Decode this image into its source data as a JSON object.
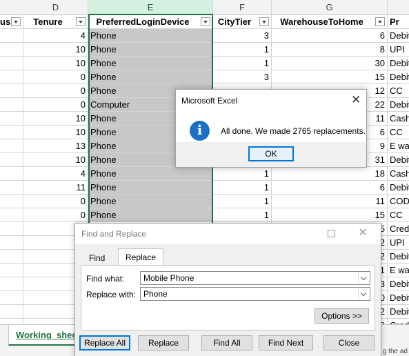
{
  "sheet": {
    "columns": [
      "D",
      "E",
      "F",
      "G"
    ],
    "header_cells": [
      "us",
      "Tenure",
      "PreferredLoginDevice",
      "CityTier",
      "WarehouseToHome",
      "Pr"
    ],
    "rows": [
      {
        "tenure": "4",
        "device": "Phone",
        "tier": "3",
        "wh": "6",
        "pay": "Debit"
      },
      {
        "tenure": "10",
        "device": "Phone",
        "tier": "1",
        "wh": "8",
        "pay": "UPI"
      },
      {
        "tenure": "10",
        "device": "Phone",
        "tier": "1",
        "wh": "30",
        "pay": "Debit"
      },
      {
        "tenure": "0",
        "device": "Phone",
        "tier": "3",
        "wh": "15",
        "pay": "Debit"
      },
      {
        "tenure": "0",
        "device": "Phone",
        "tier": "",
        "wh": "12",
        "pay": "CC"
      },
      {
        "tenure": "0",
        "device": "Computer",
        "tier": "",
        "wh": "22",
        "pay": "Debit"
      },
      {
        "tenure": "10",
        "device": "Phone",
        "tier": "",
        "wh": "11",
        "pay": "Cash"
      },
      {
        "tenure": "10",
        "device": "Phone",
        "tier": "",
        "wh": "6",
        "pay": "CC"
      },
      {
        "tenure": "13",
        "device": "Phone",
        "tier": "",
        "wh": "9",
        "pay": "E wal"
      },
      {
        "tenure": "10",
        "device": "Phone",
        "tier": "",
        "wh": "31",
        "pay": "Debit"
      },
      {
        "tenure": "4",
        "device": " Phone",
        "tier": "1",
        "wh": "18",
        "pay": "Cash"
      },
      {
        "tenure": "11",
        "device": " Phone",
        "tier": "1",
        "wh": "6",
        "pay": "Debit"
      },
      {
        "tenure": "0",
        "device": "Phone",
        "tier": "1",
        "wh": "11",
        "pay": "COD"
      },
      {
        "tenure": "0",
        "device": "Phone",
        "tier": "1",
        "wh": "15",
        "pay": "CC"
      },
      {
        "wh": "5",
        "pay": "Cred"
      },
      {
        "wh": "2",
        "pay": "UPI"
      },
      {
        "wh": "2",
        "pay": "Debit"
      },
      {
        "wh": "1",
        "pay": "E wal"
      },
      {
        "wh": "3",
        "pay": "Debit"
      },
      {
        "wh": "0",
        "pay": "Debit"
      },
      {
        "wh": "2",
        "pay": "Debit"
      },
      {
        "wh": "9",
        "pay": "Cred"
      }
    ],
    "sheet_tab": "Working_shee",
    "status_text": "g the ad"
  },
  "message_box": {
    "title": "Microsoft Excel",
    "message": "All done. We made 2765 replacements.",
    "ok_label": "OK",
    "icon": "info-icon"
  },
  "find_replace": {
    "title": "Find and Replace",
    "tab_find": "Find",
    "tab_replace": "Replace",
    "find_label": "Find what:",
    "find_value": "Mobile Phone",
    "replace_label": "Replace with:",
    "replace_value": "Phone",
    "options_label": "Options >>",
    "replace_all_label": "Replace All",
    "replace_label_btn": "Replace",
    "find_all_label": "Find All",
    "find_next_label": "Find Next",
    "close_label": "Close"
  },
  "colors": {
    "excel_green": "#217346",
    "selection_gray": "#c8c8c8",
    "focus_blue": "#0078d7",
    "info_blue": "#1a6fc7"
  }
}
